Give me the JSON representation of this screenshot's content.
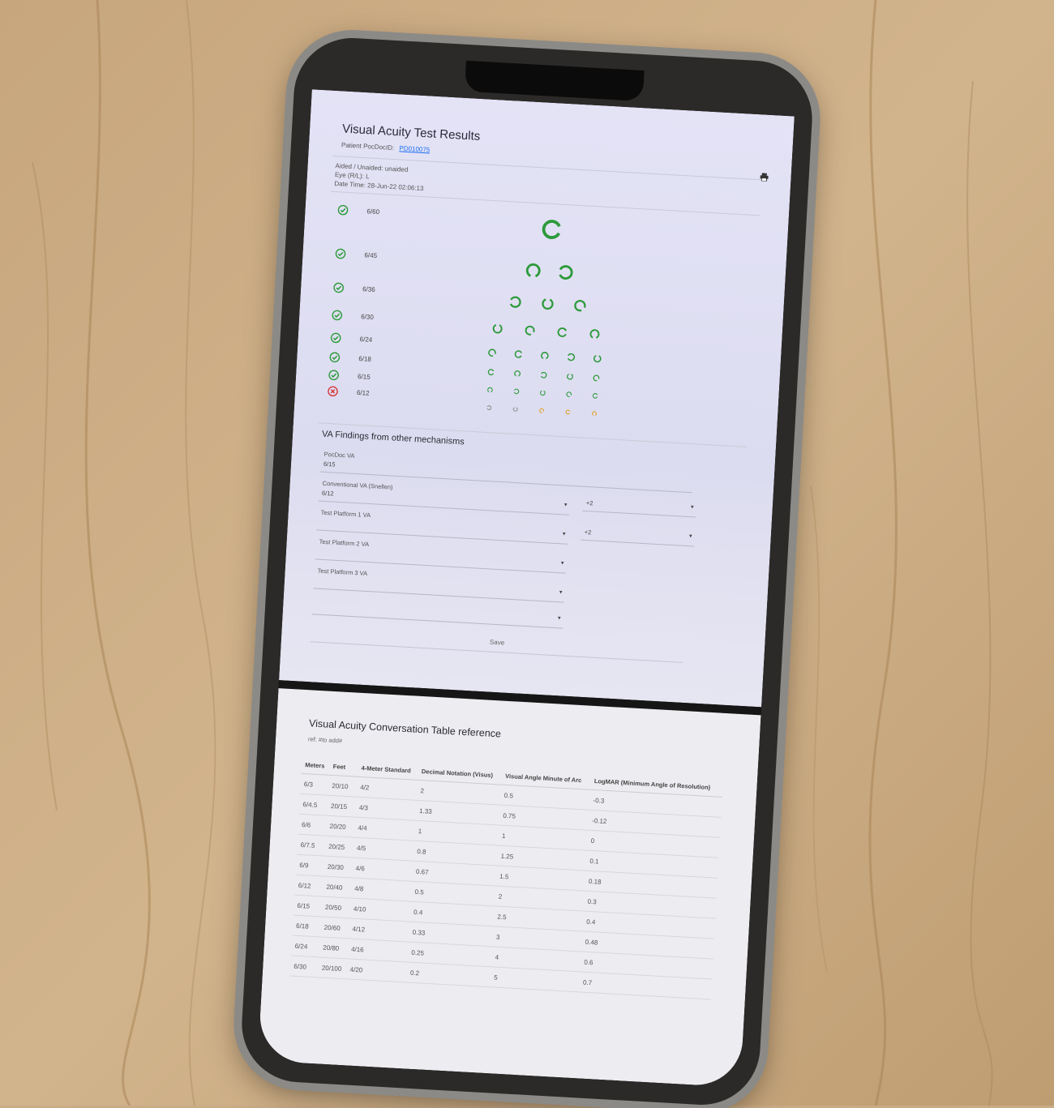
{
  "header": {
    "title": "Visual Acuity Test Results",
    "patient_label": "Patient PocDocID:",
    "patient_id": "PD010075",
    "print_icon": "printer-icon"
  },
  "meta": {
    "aided": "Aided / Unaided: unaided",
    "eye": "Eye (R/L): L",
    "datetime": "Date Time: 28-Jun-22 02:06:13"
  },
  "results": [
    {
      "label": "6/60",
      "status": "pass"
    },
    {
      "label": "6/45",
      "status": "pass"
    },
    {
      "label": "6/36",
      "status": "pass"
    },
    {
      "label": "6/30",
      "status": "pass"
    },
    {
      "label": "6/24",
      "status": "pass"
    },
    {
      "label": "6/18",
      "status": "pass"
    },
    {
      "label": "6/15",
      "status": "pass"
    },
    {
      "label": "6/12",
      "status": "fail"
    }
  ],
  "colors": {
    "pass": "#2c9a3a",
    "fail": "#d63a3a",
    "partial": "#e0a020",
    "missed": "#888888"
  },
  "findings": {
    "title": "VA Findings from other mechanisms",
    "pocdoc_label": "PocDoc VA",
    "pocdoc_value": "6/15",
    "conventional_label": "Conventional VA (Snellen)",
    "conventional_value": "6/12",
    "conventional_modifier": "+2",
    "platform1_label": "Test Platform 1 VA",
    "platform1_modifier": "+2",
    "platform2_label": "Test Platform 2 VA",
    "platform3_label": "Test Platform 3 VA",
    "save_label": "Save"
  },
  "reference": {
    "title": "Visual Acuity Conversation Table reference",
    "ref": "ref: #to add#",
    "columns": [
      "Meters",
      "Feet",
      "4-Meter Standard",
      "Decimal Notation (Visus)",
      "Visual Angle Minute of Arc",
      "LogMAR (Minimum Angle of Resolution)"
    ],
    "rows": [
      [
        "6/3",
        "20/10",
        "4/2",
        "2",
        "0.5",
        "-0.3"
      ],
      [
        "6/4.5",
        "20/15",
        "4/3",
        "1.33",
        "0.75",
        "-0.12"
      ],
      [
        "6/6",
        "20/20",
        "4/4",
        "1",
        "1",
        "0"
      ],
      [
        "6/7.5",
        "20/25",
        "4/5",
        "0.8",
        "1.25",
        "0.1"
      ],
      [
        "6/9",
        "20/30",
        "4/6",
        "0.67",
        "1.5",
        "0.18"
      ],
      [
        "6/12",
        "20/40",
        "4/8",
        "0.5",
        "2",
        "0.3"
      ],
      [
        "6/15",
        "20/50",
        "4/10",
        "0.4",
        "2.5",
        "0.4"
      ],
      [
        "6/18",
        "20/60",
        "4/12",
        "0.33",
        "3",
        "0.48"
      ],
      [
        "6/24",
        "20/80",
        "4/16",
        "0.25",
        "4",
        "0.6"
      ],
      [
        "6/30",
        "20/100",
        "4/20",
        "0.2",
        "5",
        "0.7"
      ]
    ]
  }
}
